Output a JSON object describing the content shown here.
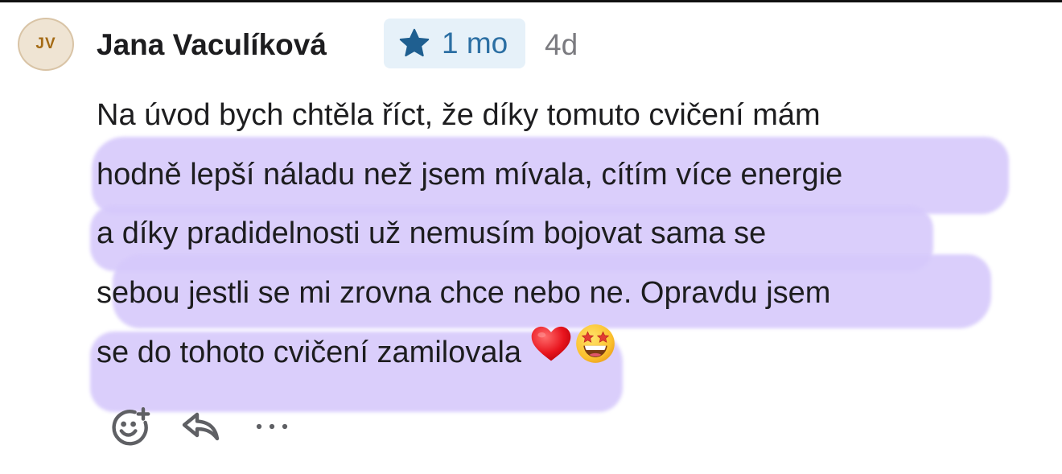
{
  "comment": {
    "avatar_initials": "JV",
    "author_name": "Jana Vaculíková",
    "badge": {
      "icon": "star-icon",
      "label": "1 mo",
      "color": "#2c6fa3",
      "background": "#e6f1f9"
    },
    "timestamp": "4d",
    "body_lines": [
      "Na úvod bych chtěla říct, že díky tomuto cvičení mám",
      "hodně lepší náladu než jsem mívala, cítím více energie",
      "a díky pradidelnosti už nemusím bojovat sama se",
      "sebou jestli se mi zrovna chce nebo ne. Opravdu jsem",
      "se do tohoto cvičení zamilovala"
    ],
    "emojis": [
      "red-heart-emoji",
      "star-struck-emoji"
    ],
    "highlight_color": "#d6c9fb"
  },
  "actions": [
    {
      "icon": "add-reaction-icon"
    },
    {
      "icon": "reply-icon"
    },
    {
      "icon": "more-icon"
    }
  ]
}
